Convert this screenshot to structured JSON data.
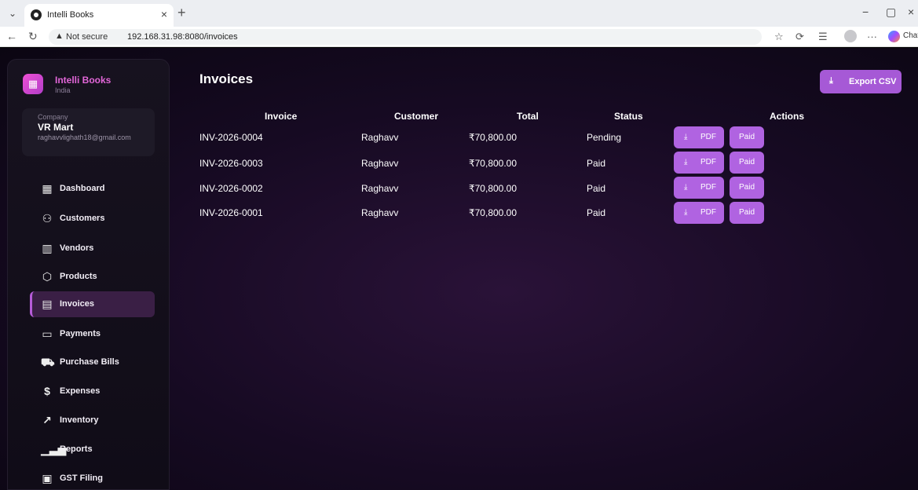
{
  "browser": {
    "tab_title": "Intelli Books",
    "url_security": "Not secure",
    "url": "192.168.31.98:8080/invoices",
    "chat_label": "Chat"
  },
  "sidebar": {
    "brand_name": "Intelli Books",
    "brand_country": "India",
    "company_label": "Company",
    "company_name": "VR Mart",
    "company_email": "raghavvlighath18@gmail.com",
    "items": [
      {
        "label": "Dashboard",
        "icon": "dashboard-icon"
      },
      {
        "label": "Customers",
        "icon": "users-icon"
      },
      {
        "label": "Vendors",
        "icon": "building-icon"
      },
      {
        "label": "Products",
        "icon": "box-icon"
      },
      {
        "label": "Invoices",
        "icon": "document-icon"
      },
      {
        "label": "Payments",
        "icon": "card-icon"
      },
      {
        "label": "Purchase Bills",
        "icon": "cart-icon"
      },
      {
        "label": "Expenses",
        "icon": "dollar-icon"
      },
      {
        "label": "Inventory",
        "icon": "trend-icon"
      },
      {
        "label": "Reports",
        "icon": "bar-chart-icon"
      },
      {
        "label": "GST Filing",
        "icon": "calculator-icon"
      }
    ],
    "active": "Invoices"
  },
  "main": {
    "title": "Invoices",
    "export_label": "Export CSV",
    "columns": [
      "Invoice",
      "Customer",
      "Total",
      "Status",
      "Actions"
    ],
    "pdf_label": "PDF",
    "paid_label": "Paid",
    "rows": [
      {
        "invoice": "INV-2026-0004",
        "customer": "Raghavv",
        "total": "₹70,800.00",
        "status": "Pending"
      },
      {
        "invoice": "INV-2026-0003",
        "customer": "Raghavv",
        "total": "₹70,800.00",
        "status": "Paid"
      },
      {
        "invoice": "INV-2026-0002",
        "customer": "Raghavv",
        "total": "₹70,800.00",
        "status": "Paid"
      },
      {
        "invoice": "INV-2026-0001",
        "customer": "Raghavv",
        "total": "₹70,800.00",
        "status": "Paid"
      }
    ]
  },
  "colors": {
    "accent": "#b063e1",
    "brand": "#e266d8",
    "active_nav": "#3a1f45"
  }
}
